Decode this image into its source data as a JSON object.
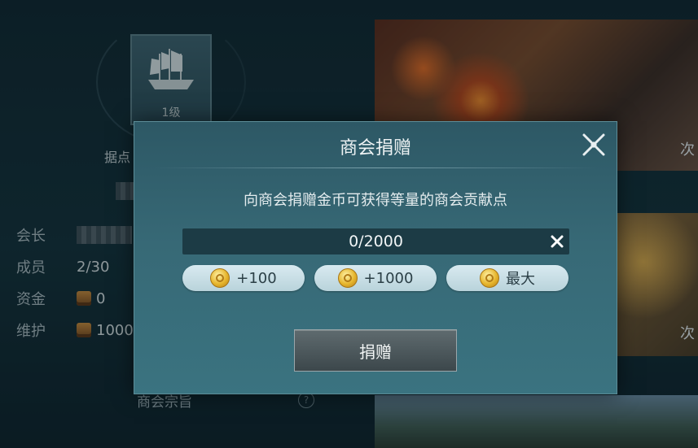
{
  "background": {
    "emblem_level": "1级",
    "stronghold_label": "据点",
    "info_rows": [
      {
        "label": "会长",
        "value": ""
      },
      {
        "label": "成员",
        "value": "2/30"
      },
      {
        "label": "资金",
        "value": "0"
      },
      {
        "label": "维护",
        "value": "1000"
      }
    ],
    "purpose_label": "商会宗旨",
    "card_tags": [
      "次",
      "次"
    ]
  },
  "dialog": {
    "title": "商会捐赠",
    "description": "向商会捐赠金币可获得等量的商会贡献点",
    "amount_value": "0/2000",
    "quick_buttons": [
      {
        "label": "+100",
        "icon": "gold-coin-icon"
      },
      {
        "label": "+1000",
        "icon": "gold-coin-icon"
      },
      {
        "label": "最大",
        "icon": "gold-coin-icon"
      }
    ],
    "donate_label": "捐赠"
  },
  "colors": {
    "dialog_bg": "#376976",
    "pill_bg": "#c9dfe6",
    "coin": "#e6b52c"
  }
}
